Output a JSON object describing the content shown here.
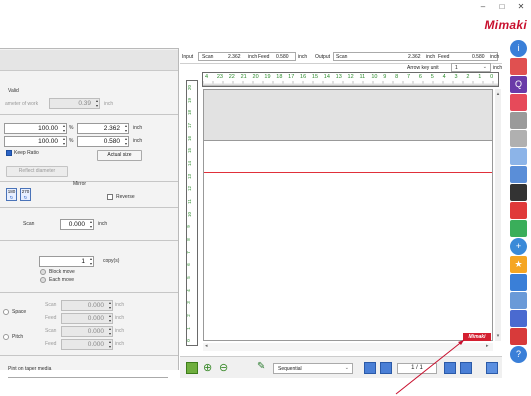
{
  "window": {
    "minimize": "–",
    "maximize": "□",
    "close": "✕",
    "brand": "Mimaki"
  },
  "readout": {
    "input_label": "Input",
    "scan1_label": "Scan",
    "scan1_value": "2.362",
    "scan1_unit": "inch",
    "feed1_label": "Feed",
    "feed1_value": "0.580",
    "feed1_unit": "inch",
    "output_label": "Output",
    "scan2_label": "Scan",
    "scan2_value": "2.362",
    "scan2_unit": "inch",
    "feed2_label": "Feed",
    "feed2_value": "0.580",
    "feed2_unit": "inch",
    "arrow_key_label": "Arrow key unit",
    "arrow_key_value": "1",
    "arrow_key_unit": "inch"
  },
  "left": {
    "valid_label": "Valid",
    "diameter_label": "ameter of work",
    "diameter_value": "0.39",
    "diameter_unit": "inch",
    "size_w_pct": "100.00",
    "size_pct_unit": "%",
    "size_h_pct": "100.00",
    "size_w_inch": "2.362",
    "size_h_inch": "0.580",
    "size_inch_unit": "inch",
    "keep_ratio": "Keep Ratio",
    "actual_size": "Actual size",
    "reflect_diameter": "Reflect diameter",
    "rot180": "180",
    "rot270": "270",
    "mirror_label": "Mirror",
    "reverse_label": "Reverse",
    "scan_label": "Scan",
    "scan_value": "0.000",
    "scan_unit": "inch",
    "copies_value": "1",
    "copies_label": "copy(s)",
    "block_move": "Block move",
    "each_move": "Each move",
    "space_label": "Space",
    "pitch_label": "Pitch",
    "sp_scan_label": "Scan",
    "sp_scan_value": "0.000",
    "sp_scan_unit": "inch",
    "sp_feed_label": "Feed",
    "sp_feed_value": "0.000",
    "sp_feed_unit": "inch",
    "pt_scan_label": "Scan",
    "pt_scan_value": "0.000",
    "pt_scan_unit": "inch",
    "pt_feed_label": "Feed",
    "pt_feed_value": "0.000",
    "pt_feed_unit": "inch",
    "taper_label": "Pint on taper media"
  },
  "ruler_top": [
    "4",
    "23",
    "22",
    "21",
    "20",
    "19",
    "18",
    "17",
    "16",
    "15",
    "14",
    "13",
    "12",
    "11",
    "10",
    "9",
    "8",
    "7",
    "6",
    "5",
    "4",
    "3",
    "2",
    "1",
    "0"
  ],
  "ruler_left": [
    "20",
    "19",
    "18",
    "17",
    "16",
    "15",
    "14",
    "13",
    "12",
    "11",
    "10",
    "9",
    "8",
    "7",
    "6",
    "5",
    "4",
    "3",
    "2",
    "1",
    "0"
  ],
  "canvas": {
    "logo": "Mimaki"
  },
  "bottombar": {
    "mode": "Sequential",
    "page": "1 / 1"
  },
  "colors": {
    "accent": "#c8102e",
    "guide_line": "#e0303a",
    "ruler_green": "#2a8a2a"
  }
}
